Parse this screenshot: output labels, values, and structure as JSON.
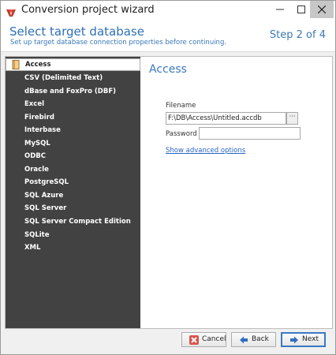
{
  "window": {
    "title": "Conversion project wizard"
  },
  "header": {
    "title": "Select target database",
    "subtitle": "Set up target database connection properties before continuing.",
    "step": "Step 2 of 4"
  },
  "sidebar": {
    "items": [
      {
        "label": "Access",
        "selected": true
      },
      {
        "label": "CSV (Delimited Text)"
      },
      {
        "label": "dBase and FoxPro (DBF)"
      },
      {
        "label": "Excel"
      },
      {
        "label": "Firebird"
      },
      {
        "label": "Interbase"
      },
      {
        "label": "MySQL"
      },
      {
        "label": "ODBC"
      },
      {
        "label": "Oracle"
      },
      {
        "label": "PostgreSQL"
      },
      {
        "label": "SQL Azure"
      },
      {
        "label": "SQL Server"
      },
      {
        "label": "SQL Server Compact Edition"
      },
      {
        "label": "SQLite"
      },
      {
        "label": "XML"
      }
    ]
  },
  "content": {
    "title": "Access",
    "filename_label": "Filename",
    "filename_value": "F:\\DB\\Access\\Untitled.accdb",
    "browse_label": "···",
    "password_label": "Password",
    "password_value": "",
    "advanced_link": "Show advanced options"
  },
  "footer": {
    "cancel_label": "Cancel",
    "back_label": "Back",
    "next_label": "Next"
  },
  "colors": {
    "accent": "#3b78b9",
    "sidebar_bg": "#424242",
    "link": "#2a64c5"
  }
}
